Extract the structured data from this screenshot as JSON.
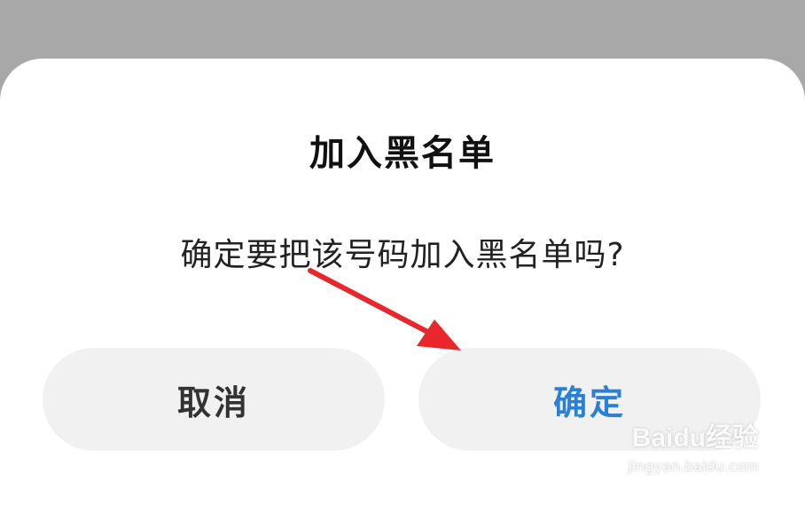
{
  "dialog": {
    "title": "加入黑名单",
    "message": "确定要把该号码加入黑名单吗?",
    "cancel_label": "取消",
    "confirm_label": "确定"
  },
  "colors": {
    "confirm_text": "#2b7fd4",
    "arrow": "#e8262b",
    "backdrop": "#a8a8a8"
  },
  "watermark": {
    "main": "Baidu经验",
    "sub": "jingyan.baidu.com"
  }
}
